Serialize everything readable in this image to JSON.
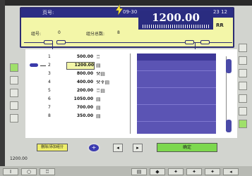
{
  "header": {
    "left_label": "页号:",
    "mid_label": "09-30",
    "right_label": "23 12",
    "main_value": "1200.00",
    "unit": "RR",
    "field1_label": "组号:",
    "field1_value": "0",
    "field2_label": "组分总数:",
    "field2_value": "8"
  },
  "list": {
    "selected_index": 2,
    "rows": [
      {
        "idx": "1",
        "value": "500.00",
        "icon": "weight-icon"
      },
      {
        "idx": "2",
        "value": "1200.00",
        "icon": "doc-icon"
      },
      {
        "idx": "3",
        "value": "800.00",
        "icon": "tools-icon"
      },
      {
        "idx": "4",
        "value": "400.00",
        "icon": "tools-icon"
      },
      {
        "idx": "5",
        "value": "200.00",
        "icon": "weight-icon"
      },
      {
        "idx": "6",
        "value": "1050.00",
        "icon": "doc-icon"
      },
      {
        "idx": "7",
        "value": "700.00",
        "icon": "doc-icon"
      },
      {
        "idx": "8",
        "value": "350.00",
        "icon": "doc-icon"
      }
    ]
  },
  "controls": {
    "yellow_button": "删除/添加组分",
    "green_button": "确定"
  },
  "status": {
    "value": "1200.00"
  }
}
